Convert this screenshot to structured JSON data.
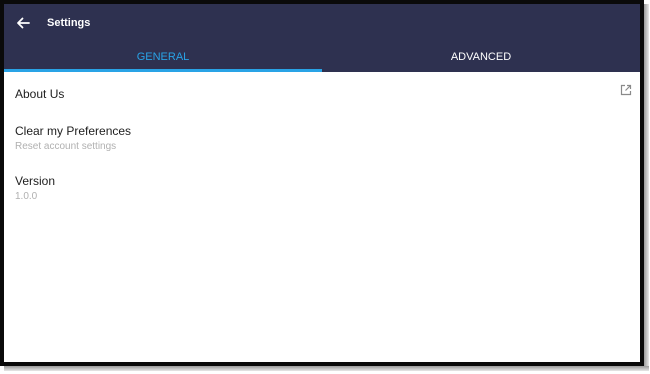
{
  "header": {
    "title": "Settings",
    "back_icon": "arrow-left-icon",
    "background": "#2e3150"
  },
  "tabs": [
    {
      "label": "GENERAL",
      "active": true
    },
    {
      "label": "ADVANCED",
      "active": false
    }
  ],
  "accent_color": "#29a3e6",
  "settings": {
    "about": {
      "title": "About Us",
      "icon": "external-link-icon"
    },
    "clear_prefs": {
      "title": "Clear my Preferences",
      "subtitle": "Reset account settings"
    },
    "version": {
      "title": "Version",
      "value": "1.0.0"
    }
  }
}
